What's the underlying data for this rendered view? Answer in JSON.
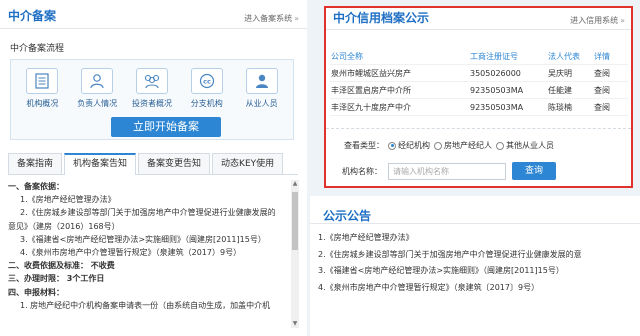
{
  "left": {
    "title": "中介备案",
    "link": "进入备案系统",
    "link_arrow": "»",
    "flow_title": "中介备案流程",
    "flow_items": [
      {
        "label": "机构概况",
        "icon": "list-document-icon"
      },
      {
        "label": "负责人情况",
        "icon": "person-icon"
      },
      {
        "label": "投资者概况",
        "icon": "group-icon"
      },
      {
        "label": "分支机构",
        "icon": "branch-cc-icon"
      },
      {
        "label": "从业人员",
        "icon": "staff-icon"
      }
    ],
    "start_button": "立即开始备案",
    "tabs": [
      "备案指南",
      "机构备案告知",
      "备案变更告知",
      "动态KEY使用"
    ],
    "active_tab": 1,
    "doc_lines": [
      "一、备案依据：",
      "1.《房地产经纪管理办法》",
      "2.《住房城乡建设部等部门关于加强房地产中介管理促进行业健康发展的",
      "意见》（建房（2016）168号）",
      "3.《福建省<房地产经纪管理办法>实施细则》（闽建房[2011]15号）",
      "4.《泉州市房地产中介管理暂行规定》（泉建筑（2017）9号）",
      "二、收费依据及标准：  不收费",
      "三、办理时限：  3个工作日",
      "四、申报材料：",
      "1. 房地产经纪中介机构备案申请表一份（由系统自动生成，加盖中介机"
    ]
  },
  "credit": {
    "title": "中介信用档案公示",
    "link": "进入信用系统",
    "link_arrow": "»",
    "headers": [
      "公司全称",
      "工商注册证号",
      "法人代表",
      "详情"
    ],
    "rows": [
      [
        "泉州市鲤城区益兴房产",
        "3505026000",
        "吴庆明",
        "查阅"
      ],
      [
        "丰泽区置启房产中介所",
        "92350503MA",
        "任能建",
        "查阅"
      ],
      [
        "丰泽区九十度房产中介",
        "92350503MA",
        "陈琰楠",
        "查阅"
      ]
    ],
    "query_type_label": "查看类型：",
    "radios": [
      "经纪机构",
      "房地产经纪人",
      "其他从业人员"
    ],
    "selected_radio": 0,
    "name_label": "机构名称：",
    "name_placeholder": "请输入机构名称",
    "query_button": "查询"
  },
  "notice": {
    "title": "公示公告",
    "items": [
      "1.《房地产经纪管理办法》",
      "2.《住房城乡建设部等部门关于加强房地产中介管理促进行业健康发展的意",
      "3.《福建省<房地产经纪管理办法>实施细则》（闽建房[2011]15号）",
      "4.《泉州市房地产中介管理暂行规定》（泉建筑〔2017〕9号）"
    ]
  },
  "colors": {
    "accent": "#2d86d3",
    "highlight_border": "#e0312d"
  }
}
